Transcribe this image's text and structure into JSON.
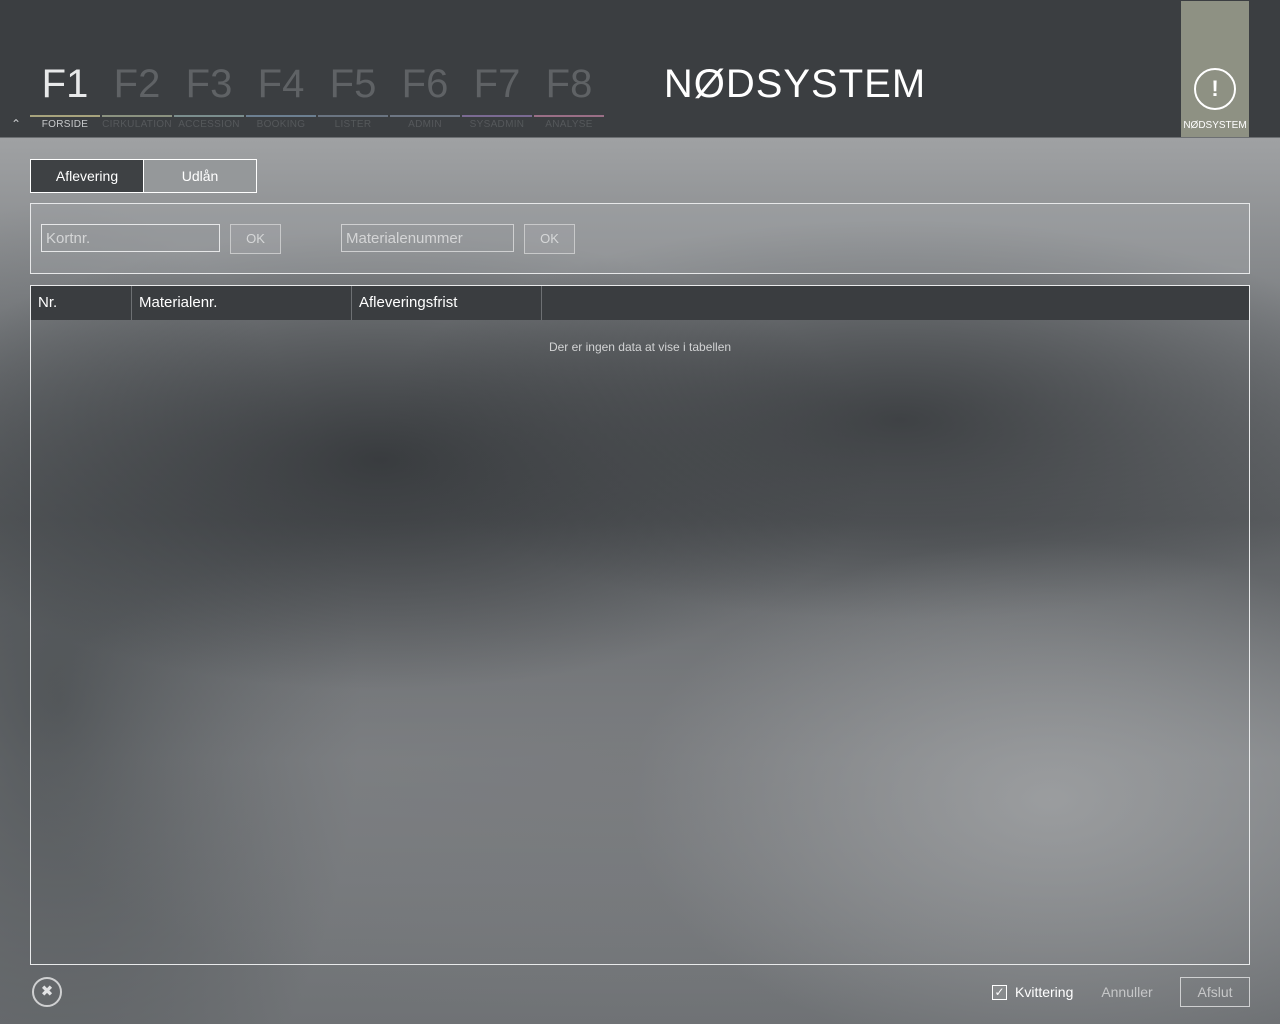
{
  "header": {
    "app_title": "NØDSYSTEM",
    "emergency_label": "NØDSYSTEM",
    "emergency_tile_color": "#8e9183",
    "collapse_icon": "chevron-up-icon",
    "fkeys": [
      {
        "key": "F1",
        "label": "FORSIDE",
        "active": true,
        "color": "#a7a37d"
      },
      {
        "key": "F2",
        "label": "CIRKULATION",
        "active": false,
        "color": "#8b9280"
      },
      {
        "key": "F3",
        "label": "ACCESSION",
        "active": false,
        "color": "#7b8e8e"
      },
      {
        "key": "F4",
        "label": "BOOKING",
        "active": false,
        "color": "#6c7f91"
      },
      {
        "key": "F5",
        "label": "LISTER",
        "active": false,
        "color": "#6a7481"
      },
      {
        "key": "F6",
        "label": "ADMIN",
        "active": false,
        "color": "#6d7683"
      },
      {
        "key": "F7",
        "label": "SYSADMIN",
        "active": false,
        "color": "#7a6a92"
      },
      {
        "key": "F8",
        "label": "ANALYSE",
        "active": false,
        "color": "#9a6f86"
      }
    ]
  },
  "tabs": {
    "return_label": "Aflevering",
    "loan_label": "Udlån",
    "selected": "Udlån"
  },
  "inputs": {
    "card_placeholder": "Kortnr.",
    "card_value": "",
    "card_ok": "OK",
    "material_placeholder": "Materialenummer",
    "material_value": "",
    "material_ok": "OK"
  },
  "table": {
    "columns": [
      "Nr.",
      "Materialenr.",
      "Afleveringsfrist",
      ""
    ],
    "rows": [],
    "empty_message": "Der er ingen data at vise i tabellen"
  },
  "footer": {
    "close_icon": "close-circle-icon",
    "receipt_label": "Kvittering",
    "receipt_checked": true,
    "cancel_label": "Annuller",
    "finish_label": "Afslut"
  }
}
